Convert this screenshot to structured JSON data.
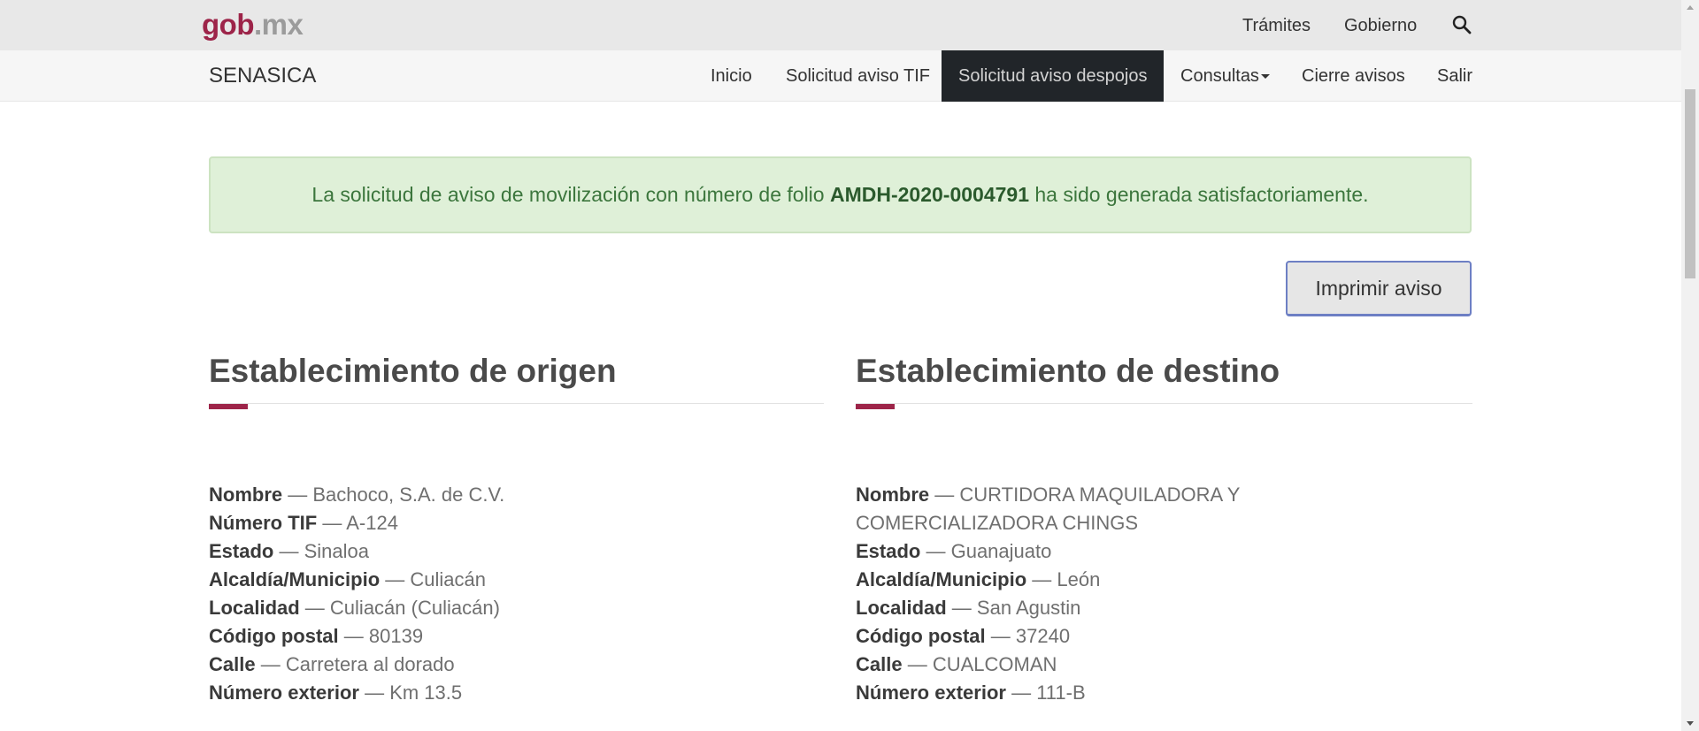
{
  "gob_header": {
    "logo_gob": "gob",
    "logo_dot_mx": ".mx",
    "links": [
      "Trámites",
      "Gobierno"
    ],
    "search_icon": "search-icon"
  },
  "app_nav": {
    "brand": "SENASICA",
    "items": [
      "Inicio",
      "Solicitud aviso TIF",
      "Solicitud aviso despojos",
      "Consultas",
      "Cierre avisos",
      "Salir"
    ],
    "active_item": "Solicitud aviso despojos"
  },
  "alert": {
    "text_before": "La solicitud de aviso de movilización con número de folio ",
    "folio": "AMDH-2020-0004791",
    "text_after": " ha sido generada satisfactoriamente."
  },
  "actions": {
    "print_label": "Imprimir aviso"
  },
  "origin": {
    "title": "Establecimiento de origen",
    "fields": [
      {
        "label": "Nombre",
        "value": "Bachoco, S.A. de C.V."
      },
      {
        "label": "Número TIF",
        "value": "A-124"
      },
      {
        "label": "Estado",
        "value": "Sinaloa"
      },
      {
        "label": "Alcaldía/Municipio",
        "value": "Culiacán"
      },
      {
        "label": "Localidad",
        "value": "Culiacán (Culiacán)"
      },
      {
        "label": "Código postal",
        "value": "80139"
      },
      {
        "label": "Calle",
        "value": "Carretera al dorado"
      },
      {
        "label": "Número exterior",
        "value": "Km 13.5"
      }
    ]
  },
  "destination": {
    "title": "Establecimiento de destino",
    "fields": [
      {
        "label": "Nombre",
        "value": "CURTIDORA MAQUILADORA Y COMERCIALIZADORA CHINGS"
      },
      {
        "label": "Estado",
        "value": "Guanajuato"
      },
      {
        "label": "Alcaldía/Municipio",
        "value": "León"
      },
      {
        "label": "Localidad",
        "value": "San Agustin"
      },
      {
        "label": "Código postal",
        "value": "37240"
      },
      {
        "label": "Calle",
        "value": "CUALCOMAN"
      },
      {
        "label": "Número exterior",
        "value": "111-B"
      }
    ]
  },
  "separator": " — ",
  "colors": {
    "gob_brand": "#9d2449",
    "alert_bg": "#dff0d8",
    "alert_text": "#3c763d",
    "active_nav_bg": "#212529"
  }
}
